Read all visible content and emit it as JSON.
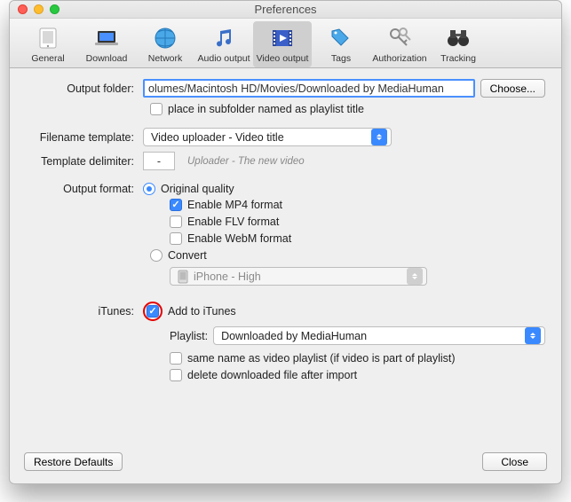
{
  "window": {
    "title": "Preferences"
  },
  "toolbar": {
    "items": [
      {
        "label": "General"
      },
      {
        "label": "Download"
      },
      {
        "label": "Network"
      },
      {
        "label": "Audio output"
      },
      {
        "label": "Video output"
      },
      {
        "label": "Tags"
      },
      {
        "label": "Authorization"
      },
      {
        "label": "Tracking"
      }
    ]
  },
  "labels": {
    "output_folder": "Output folder:",
    "filename_template": "Filename template:",
    "template_delimiter": "Template delimiter:",
    "output_format": "Output format:",
    "itunes": "iTunes:",
    "place_in_subfolder": "place in subfolder named as playlist title",
    "enable_mp4": "Enable MP4 format",
    "enable_flv": "Enable FLV format",
    "enable_webm": "Enable WebM format",
    "original_quality": "Original quality",
    "convert": "Convert",
    "add_to_itunes": "Add to iTunes",
    "playlist": "Playlist:",
    "same_name": "same name as video playlist (if video is part of playlist)",
    "delete_file": "delete downloaded file after import",
    "restore_defaults": "Restore Defaults",
    "close": "Close",
    "choose": "Choose..."
  },
  "values": {
    "output_folder": "olumes/Macintosh HD/Movies/Downloaded by MediaHuman",
    "filename_template": "Video uploader - Video title",
    "template_delimiter": "-",
    "template_hint": "Uploader - The new video",
    "convert_preset": "iPhone - High",
    "playlist": "Downloaded by MediaHuman"
  }
}
